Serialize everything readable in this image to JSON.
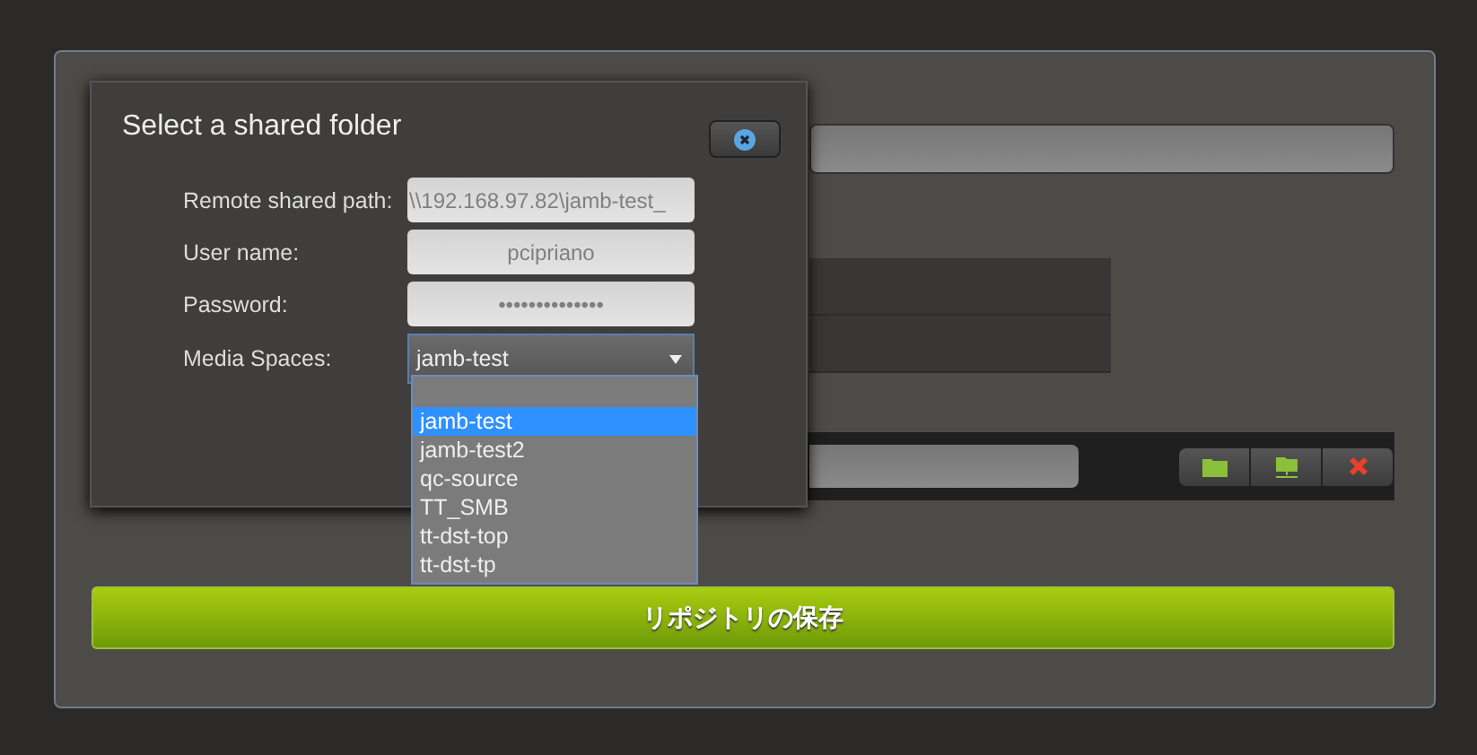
{
  "dialog": {
    "title": "Select a shared folder",
    "fields": [
      {
        "label": "Remote shared path:",
        "value": "\\\\192.168.97.82\\jamb-test_",
        "kind": "text"
      },
      {
        "label": "User name:",
        "value": "pcipriano",
        "kind": "text"
      },
      {
        "label": "Password:",
        "value": "••••••••••••••",
        "kind": "password"
      },
      {
        "label": "Media Spaces:",
        "value": "jamb-test",
        "kind": "select"
      }
    ],
    "dropdown": {
      "options": [
        {
          "label": "jamb-test",
          "selected": true
        },
        {
          "label": "jamb-test2",
          "selected": false
        },
        {
          "label": "qc-source",
          "selected": false
        },
        {
          "label": "TT_SMB",
          "selected": false
        },
        {
          "label": "tt-dst-top",
          "selected": false
        },
        {
          "label": "tt-dst-tp",
          "selected": false
        }
      ]
    }
  },
  "toolbar": {
    "buttons": [
      {
        "kind": "folder"
      },
      {
        "kind": "network-folder"
      },
      {
        "kind": "delete"
      }
    ]
  },
  "save_button": "リポジトリの保存"
}
